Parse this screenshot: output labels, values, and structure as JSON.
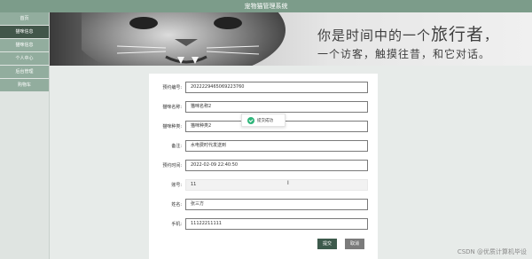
{
  "app": {
    "title": "宠物猫管理系统"
  },
  "sidebar": {
    "items": [
      {
        "label": "首页"
      },
      {
        "label": "猫咪信息"
      },
      {
        "label": "猫咪信息"
      },
      {
        "label": "个人中心"
      },
      {
        "label": "后台管理"
      },
      {
        "label": "购物车"
      }
    ]
  },
  "banner": {
    "line1_pre": "你是时间中的一个",
    "line1_big": "旅行者",
    "line1_post": "，",
    "line2": "一个访客，触摸往昔，和它对话。"
  },
  "form": {
    "fields": [
      {
        "label": "预约编号:",
        "value": "2022229465069223760"
      },
      {
        "label": "猫咪名称:",
        "value": "猫咪名称2"
      },
      {
        "label": "猫咪种类:",
        "value": "猫咪种类2"
      },
      {
        "label": "备注:",
        "value": "水电费时代发送到"
      },
      {
        "label": "预约时间:",
        "value": "2022-02-09 22:40:50"
      },
      {
        "label": "账号:",
        "value": "11"
      },
      {
        "label": "姓名:",
        "value": "张三方"
      },
      {
        "label": "手机:",
        "value": "11122211111"
      }
    ],
    "submit_label": "提交",
    "cancel_label": "取消"
  },
  "toast": {
    "message": "提交成功"
  },
  "cursor": {
    "glyph": "I"
  },
  "watermark": "CSDN @优质计算机毕设",
  "colors": {
    "topbar": "#7c9c8a",
    "sidebar_item": "#92ad9e",
    "sidebar_active": "#42564a",
    "submit": "#3d5a4c",
    "cancel": "#7b7b7b",
    "toast_icon": "#2fb57a"
  },
  "icons": {
    "toast": "success-check-icon"
  }
}
